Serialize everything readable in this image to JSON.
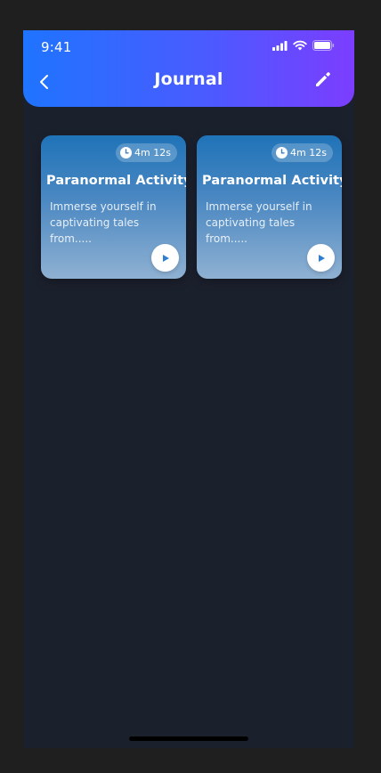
{
  "status_bar": {
    "time": "9:41"
  },
  "header": {
    "title": "Journal"
  },
  "cards": [
    {
      "duration": "4m 12s",
      "title": "Paranormal Activity",
      "description": "Immerse yourself in captivating tales from....."
    },
    {
      "duration": "4m 12s",
      "title": "Paranormal Activity",
      "description": "Immerse yourself in captivating tales from....."
    }
  ],
  "colors": {
    "header_gradient_start": "#1f74ff",
    "header_gradient_end": "#7c3dff",
    "background": "#1b202d",
    "card_gradient_top": "#1f73b8",
    "card_gradient_bottom": "#8fb1d2"
  },
  "icons": {
    "back": "chevron-left-icon",
    "edit": "pencil-icon",
    "duration": "clock-icon",
    "play": "play-icon",
    "signal": "cellular-signal-icon",
    "wifi": "wifi-icon",
    "battery": "battery-icon"
  }
}
